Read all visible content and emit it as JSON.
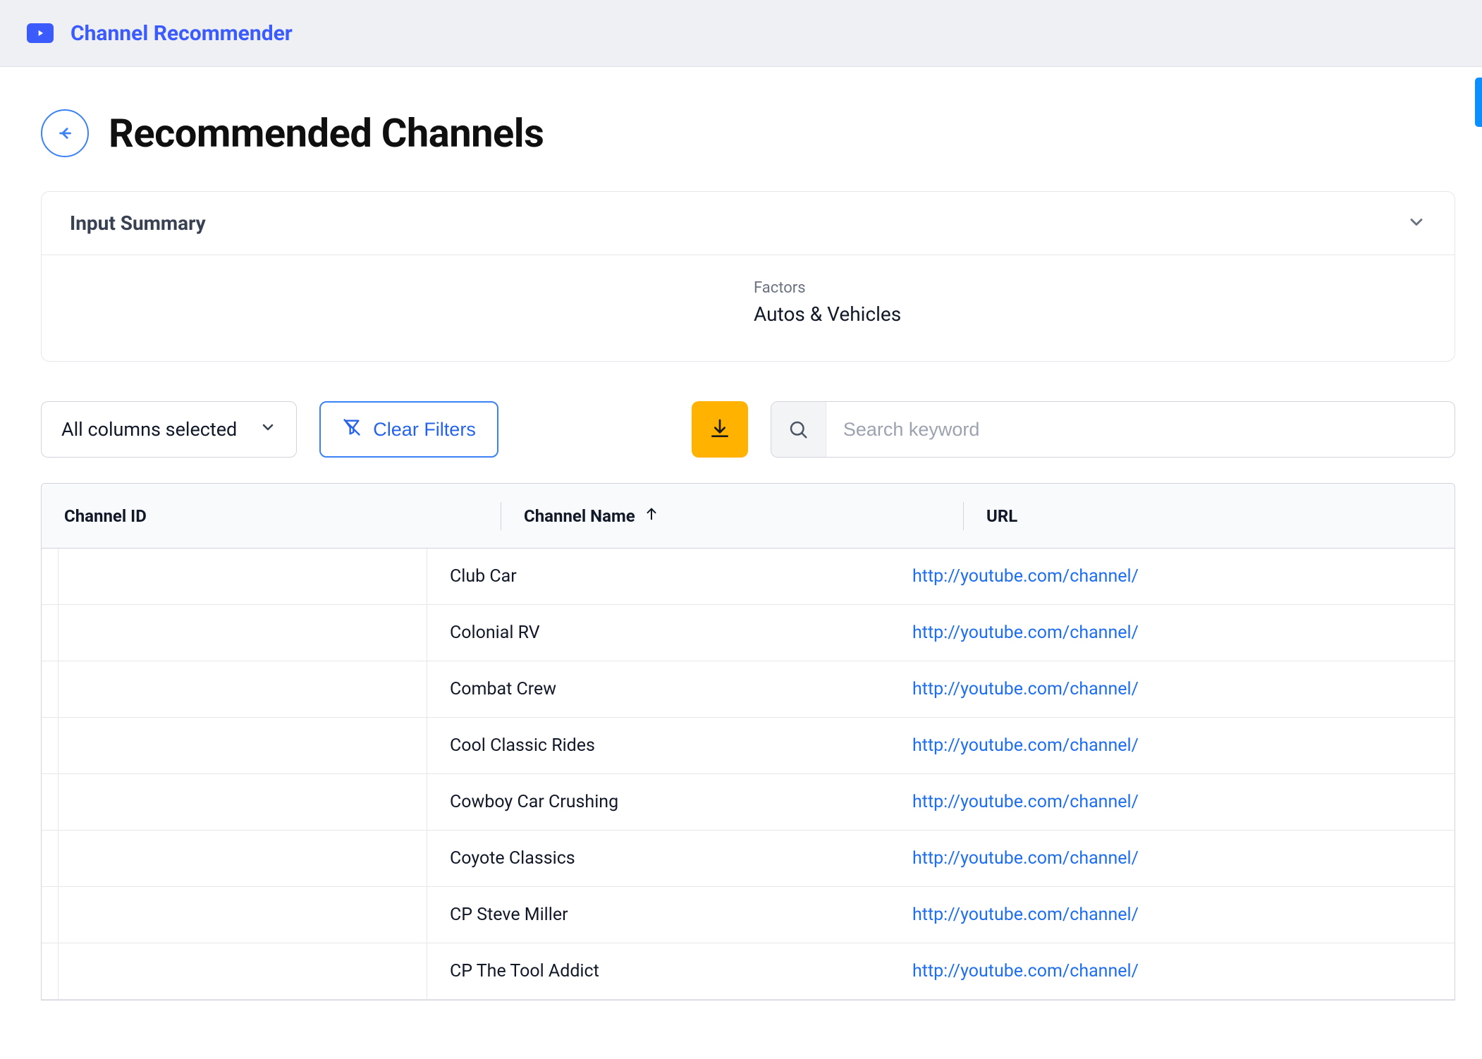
{
  "topbar": {
    "title": "Channel Recommender"
  },
  "page": {
    "title": "Recommended Channels"
  },
  "summary": {
    "heading": "Input Summary",
    "factors_label": "Factors",
    "factors_value": "Autos & Vehicles"
  },
  "toolbar": {
    "columns_label": "All columns selected",
    "clear_filters": "Clear Filters",
    "search_placeholder": "Search keyword"
  },
  "table": {
    "headers": {
      "id": "Channel ID",
      "name": "Channel Name",
      "url": "URL"
    },
    "rows": [
      {
        "id": "",
        "name": "Club Car",
        "url": "http://youtube.com/channel/"
      },
      {
        "id": "",
        "name": "Colonial RV",
        "url": "http://youtube.com/channel/"
      },
      {
        "id": "",
        "name": "Combat Crew",
        "url": "http://youtube.com/channel/"
      },
      {
        "id": "",
        "name": "Cool Classic Rides",
        "url": "http://youtube.com/channel/"
      },
      {
        "id": "",
        "name": "Cowboy Car Crushing",
        "url": "http://youtube.com/channel/"
      },
      {
        "id": "",
        "name": "Coyote Classics",
        "url": "http://youtube.com/channel/"
      },
      {
        "id": "",
        "name": "CP Steve Miller",
        "url": "http://youtube.com/channel/"
      },
      {
        "id": "",
        "name": "CP The Tool Addict",
        "url": "http://youtube.com/channel/"
      }
    ]
  }
}
